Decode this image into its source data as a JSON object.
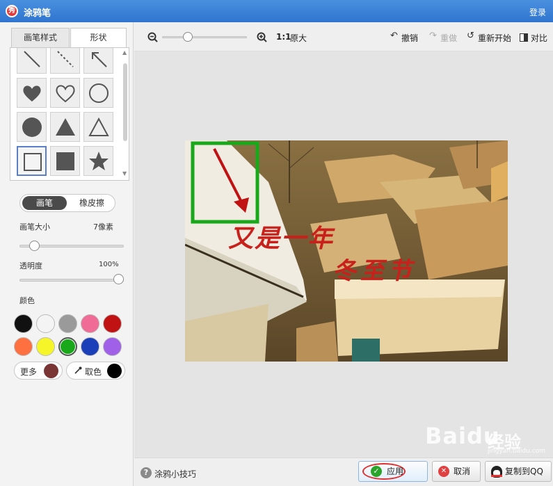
{
  "window": {
    "title": "涂鸦笔",
    "login": "登录",
    "logo_char": "秀"
  },
  "left_tabs": [
    {
      "label": "画笔样式"
    },
    {
      "label": "形状"
    }
  ],
  "shapes": [
    "line",
    "dashed-line",
    "arrow",
    "heart-filled",
    "heart-outline",
    "circle-outline",
    "circle-filled",
    "triangle-filled",
    "triangle-outline",
    "square-outline",
    "square-filled",
    "star-filled"
  ],
  "selected_shape": "square-outline",
  "mode_toggle": {
    "active": "画笔",
    "inactive": "橡皮擦"
  },
  "brush_size": {
    "label": "画笔大小",
    "value": "7像素",
    "level": 0.1
  },
  "opacity": {
    "label": "透明度",
    "value": "100%",
    "level": 1.0
  },
  "color_section": {
    "label": "颜色",
    "swatches": [
      "#111111",
      "#f4f4f4",
      "#9a9a9a",
      "#f06b96",
      "#c01212",
      "#ff7040",
      "#f5f52a",
      "#19a819",
      "#1a3fb8",
      "#a060e8"
    ],
    "selected": "#19a819",
    "more_label": "更多",
    "more_color": "#7a3535",
    "picker_label": "取色",
    "picker_color": "#000000"
  },
  "toolbar": {
    "zoom_ratio": "1:1",
    "original_label": "原大",
    "undo": "撤销",
    "redo": "重做",
    "restart": "重新开始",
    "compare": "对比",
    "zoom_level": 0.28
  },
  "photo": {
    "text_line1": "又是一年",
    "text_line2": "冬至节"
  },
  "bottom": {
    "tips": "涂鸦小技巧",
    "apply": "应用",
    "cancel": "取消",
    "copy_qq": "复制到QQ"
  },
  "watermark": {
    "brand": "Baidu",
    "sub": "经验",
    "url": "jingyan.baidu.com"
  }
}
